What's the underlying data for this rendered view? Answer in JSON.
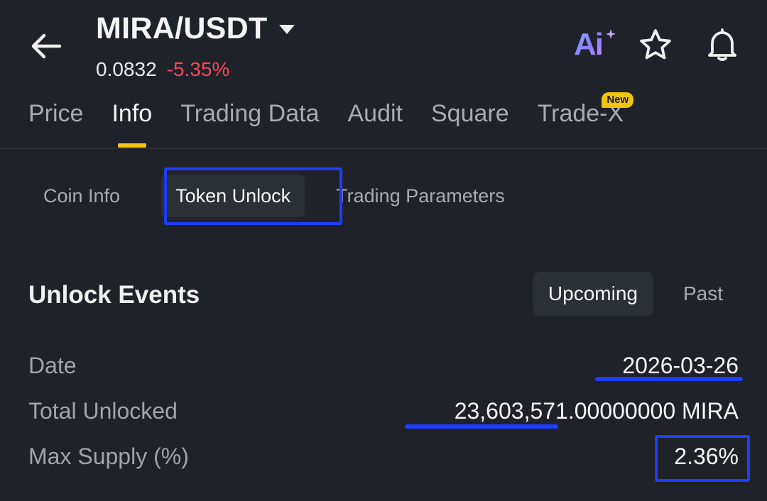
{
  "header": {
    "pair": "MIRA/USDT",
    "last_price": "0.0832",
    "change_pct": "-5.35%",
    "ai_label": "Ai",
    "icons": [
      "back-arrow-icon",
      "caret-down-icon",
      "ai-assistant-icon",
      "star-icon",
      "bell-icon"
    ]
  },
  "main_tabs": [
    {
      "label": "Price",
      "active": false
    },
    {
      "label": "Info",
      "active": true
    },
    {
      "label": "Trading Data",
      "active": false
    },
    {
      "label": "Audit",
      "active": false
    },
    {
      "label": "Square",
      "active": false
    },
    {
      "label": "Trade-X",
      "active": false,
      "badge": "New"
    }
  ],
  "sub_tabs": [
    {
      "label": "Coin Info",
      "active": false
    },
    {
      "label": "Token Unlock",
      "active": true
    },
    {
      "label": "Trading Parameters",
      "active": false
    }
  ],
  "unlock_events": {
    "title": "Unlock Events",
    "toggle": {
      "upcoming": "Upcoming",
      "past": "Past",
      "selected": "Upcoming"
    },
    "rows": [
      {
        "label": "Date",
        "value": "2026-03-26"
      },
      {
        "label": "Total Unlocked",
        "value": "23,603,571.00000000 MIRA"
      },
      {
        "label": "Max Supply (%)",
        "value": "2.36%"
      }
    ]
  },
  "colors": {
    "background": "#1f2228",
    "negative": "#f6465d",
    "accent": "#f0c511",
    "annotation": "#1f3dff",
    "text_primary": "#f5f5f5",
    "text_secondary": "#a7abb2"
  }
}
